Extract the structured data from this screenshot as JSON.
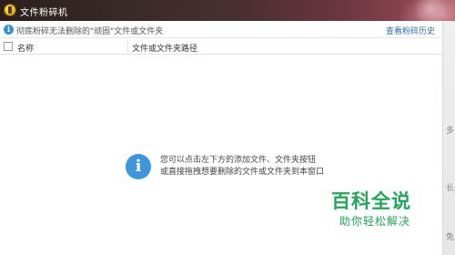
{
  "titlebar": {
    "title": "文件粉碎机"
  },
  "toolbar": {
    "info_icon": "info-icon",
    "hint": "彻底粉碎无法删除的\"顽固\"文件或文件夹",
    "history_link": "查看粉碎历史"
  },
  "table": {
    "columns": [
      "名称",
      "文件或文件夹路径"
    ]
  },
  "empty_state": {
    "icon": "info-icon",
    "line1": "您可以点击左下方的添加文件、文件夹按钮",
    "line2": "或直接拖拽想要删除的文件或文件夹到本窗口"
  },
  "right_strip": {
    "fragments": [
      "多",
      "长",
      "免"
    ]
  },
  "watermark": {
    "main": "百科全说",
    "sub": "助你轻松解决"
  },
  "colors": {
    "accent": "#2c6fb5",
    "info_blue": "#3d95dc",
    "watermark_green": "#25a55a"
  }
}
